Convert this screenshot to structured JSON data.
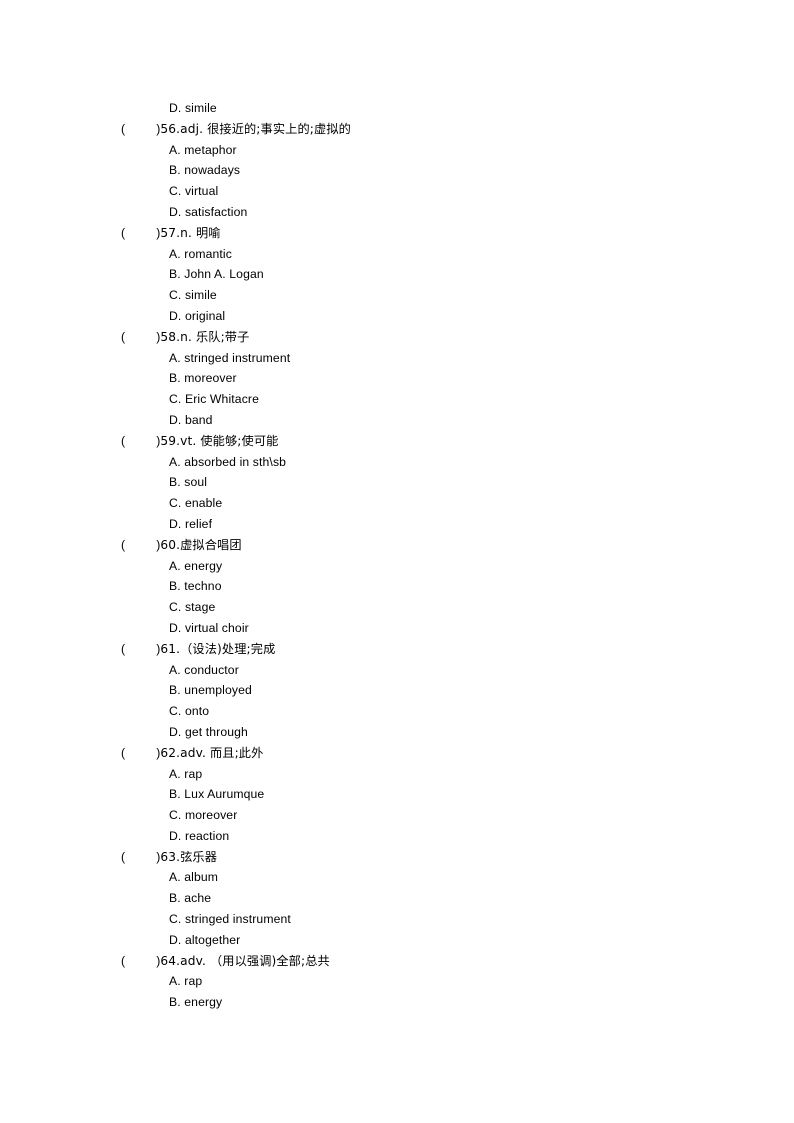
{
  "document": {
    "type": "vocabulary-multiple-choice-worksheet",
    "page_background": "#ffffff",
    "text_color": "#000000"
  },
  "orphan_option": {
    "label": "D. simile"
  },
  "questions": [
    {
      "bracket_open": "(",
      "bracket_close": ")",
      "stem": "56.adj. 很接近的;事实上的;虚拟的",
      "options": [
        "A. metaphor",
        "B. nowadays",
        "C. virtual",
        "D. satisfaction"
      ]
    },
    {
      "bracket_open": "(",
      "bracket_close": ")",
      "stem": "57.n. 明喻",
      "options": [
        "A. romantic",
        "B. John A. Logan",
        "C. simile",
        "D. original"
      ]
    },
    {
      "bracket_open": "(",
      "bracket_close": ")",
      "stem": "58.n. 乐队;带子",
      "options": [
        "A. stringed instrument",
        "B. moreover",
        "C. Eric Whitacre",
        "D. band"
      ]
    },
    {
      "bracket_open": "(",
      "bracket_close": ")",
      "stem": "59.vt. 使能够;使可能",
      "options": [
        "A. absorbed in sth\\sb",
        "B. soul",
        "C. enable",
        "D. relief"
      ]
    },
    {
      "bracket_open": "(",
      "bracket_close": ")",
      "stem": "60.虚拟合唱团",
      "options": [
        "A. energy",
        "B. techno",
        "C. stage",
        "D. virtual choir"
      ]
    },
    {
      "bracket_open": "(",
      "bracket_close": ")",
      "stem": "61.（设法)处理;完成",
      "options": [
        "A. conductor",
        "B. unemployed",
        "C. onto",
        "D. get through"
      ]
    },
    {
      "bracket_open": "(",
      "bracket_close": ")",
      "stem": "62.adv. 而且;此外",
      "options": [
        "A. rap",
        "B. Lux Aurumque",
        "C. moreover",
        "D. reaction"
      ]
    },
    {
      "bracket_open": "(",
      "bracket_close": ")",
      "stem": "63.弦乐器",
      "options": [
        "A. album",
        "B. ache",
        "C. stringed instrument",
        "D. altogether"
      ]
    },
    {
      "bracket_open": "(",
      "bracket_close": ")",
      "stem": "64.adv. （用以强调)全部;总共",
      "options": [
        "A. rap",
        "B. energy"
      ]
    }
  ]
}
